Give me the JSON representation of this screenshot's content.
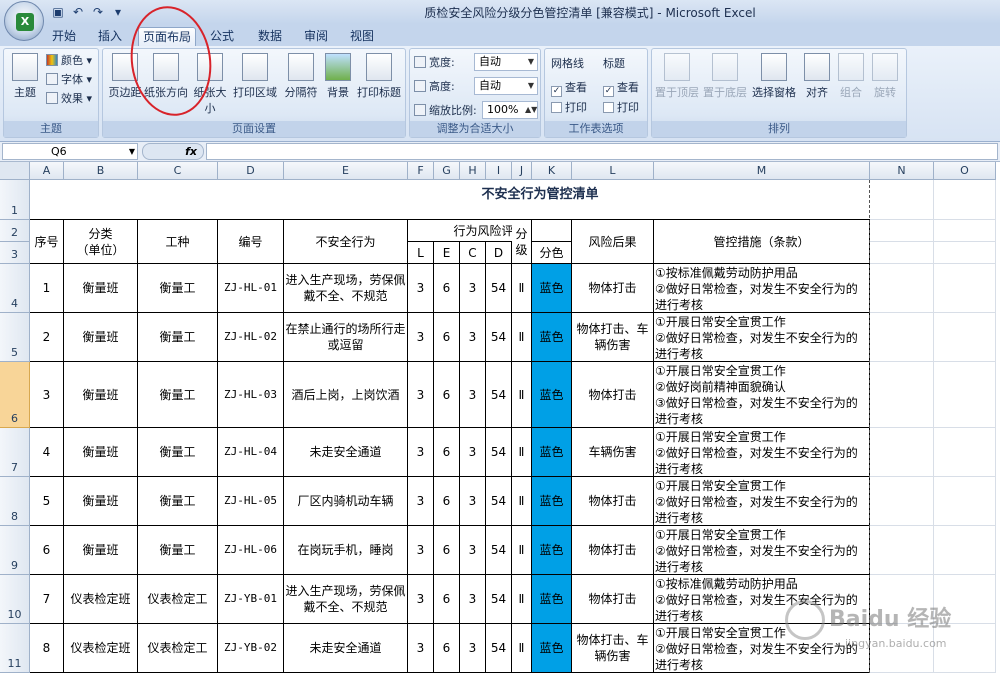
{
  "window": {
    "title": "质检安全风险分级分色管控清单 [兼容模式] - Microsoft Excel"
  },
  "tabs": [
    "开始",
    "插入",
    "页面布局",
    "公式",
    "数据",
    "审阅",
    "视图"
  ],
  "active_tab": "页面布局",
  "ribbon": {
    "theme": {
      "label": "主题",
      "big": "主题",
      "colors": "颜色",
      "fonts": "字体",
      "effects": "效果"
    },
    "pagesetup": {
      "label": "页面设置",
      "margins": "页边距",
      "orientation": "纸张方向",
      "size": "纸张大小",
      "printarea": "打印区域",
      "breaks": "分隔符",
      "background": "背景",
      "printtitles": "打印标题"
    },
    "scale": {
      "label": "调整为合适大小",
      "width_label": "宽度:",
      "width_value": "自动",
      "height_label": "高度:",
      "height_value": "自动",
      "scale_label": "缩放比例:",
      "scale_value": "100%"
    },
    "sheetopts": {
      "label": "工作表选项",
      "gridlines": "网格线",
      "headings": "标题",
      "view": "查看",
      "print": "打印"
    },
    "arrange": {
      "label": "排列",
      "front": "置于顶层",
      "back": "置于底层",
      "pane": "选择窗格",
      "align": "对齐",
      "group": "组合",
      "rotate": "旋转"
    }
  },
  "formula_bar": {
    "name_box": "Q6",
    "fx": "fx",
    "content": ""
  },
  "columns": [
    "A",
    "B",
    "C",
    "D",
    "E",
    "F",
    "G",
    "H",
    "I",
    "J",
    "K",
    "L",
    "M",
    "N",
    "O"
  ],
  "rows": [
    "1",
    "2",
    "3",
    "4",
    "5",
    "6",
    "7",
    "8",
    "9",
    "10",
    "11"
  ],
  "sheet": {
    "title": "不安全行为管控清单",
    "headers": {
      "seq": "序号",
      "category": "分类\n（单位）",
      "job": "工种",
      "code": "编号",
      "behavior": "不安全行为",
      "eval": "行为风险评价",
      "L": "L",
      "E": "E",
      "C": "C",
      "D": "D",
      "level": "分级",
      "color": "分色",
      "consequence": "风险后果",
      "measures": "管控措施（条款）"
    },
    "records": [
      {
        "seq": "1",
        "category": "衡量班",
        "job": "衡量工",
        "code": "ZJ-HL-01",
        "behavior": "进入生产现场，劳保佩戴不全、不规范",
        "L": "3",
        "E": "6",
        "C": "3",
        "D": "54",
        "level": "Ⅱ",
        "color": "蓝色",
        "consequence": "物体打击",
        "measures": "①按标准佩戴劳动防护用品\n②做好日常检查，对发生不安全行为的进行考核"
      },
      {
        "seq": "2",
        "category": "衡量班",
        "job": "衡量工",
        "code": "ZJ-HL-02",
        "behavior": "在禁止通行的场所行走或逗留",
        "L": "3",
        "E": "6",
        "C": "3",
        "D": "54",
        "level": "Ⅱ",
        "color": "蓝色",
        "consequence": "物体打击、车辆伤害",
        "measures": "①开展日常安全宣贯工作\n②做好日常检查，对发生不安全行为的进行考核"
      },
      {
        "seq": "3",
        "category": "衡量班",
        "job": "衡量工",
        "code": "ZJ-HL-03",
        "behavior": "酒后上岗，上岗饮酒",
        "L": "3",
        "E": "6",
        "C": "3",
        "D": "54",
        "level": "Ⅱ",
        "color": "蓝色",
        "consequence": "物体打击",
        "measures": "①开展日常安全宣贯工作\n②做好岗前精神面貌确认\n③做好日常检查，对发生不安全行为的进行考核"
      },
      {
        "seq": "4",
        "category": "衡量班",
        "job": "衡量工",
        "code": "ZJ-HL-04",
        "behavior": "未走安全通道",
        "L": "3",
        "E": "6",
        "C": "3",
        "D": "54",
        "level": "Ⅱ",
        "color": "蓝色",
        "consequence": "车辆伤害",
        "measures": "①开展日常安全宣贯工作\n②做好日常检查，对发生不安全行为的进行考核"
      },
      {
        "seq": "5",
        "category": "衡量班",
        "job": "衡量工",
        "code": "ZJ-HL-05",
        "behavior": "厂区内骑机动车辆",
        "L": "3",
        "E": "6",
        "C": "3",
        "D": "54",
        "level": "Ⅱ",
        "color": "蓝色",
        "consequence": "物体打击",
        "measures": "①开展日常安全宣贯工作\n②做好日常检查，对发生不安全行为的进行考核"
      },
      {
        "seq": "6",
        "category": "衡量班",
        "job": "衡量工",
        "code": "ZJ-HL-06",
        "behavior": "在岗玩手机，睡岗",
        "L": "3",
        "E": "6",
        "C": "3",
        "D": "54",
        "level": "Ⅱ",
        "color": "蓝色",
        "consequence": "物体打击",
        "measures": "①开展日常安全宣贯工作\n②做好日常检查，对发生不安全行为的进行考核"
      },
      {
        "seq": "7",
        "category": "仪表检定班",
        "job": "仪表检定工",
        "code": "ZJ-YB-01",
        "behavior": "进入生产现场，劳保佩戴不全、不规范",
        "L": "3",
        "E": "6",
        "C": "3",
        "D": "54",
        "level": "Ⅱ",
        "color": "蓝色",
        "consequence": "物体打击",
        "measures": "①按标准佩戴劳动防护用品\n②做好日常检查，对发生不安全行为的进行考核"
      },
      {
        "seq": "8",
        "category": "仪表检定班",
        "job": "仪表检定工",
        "code": "ZJ-YB-02",
        "behavior": "未走安全通道",
        "L": "3",
        "E": "6",
        "C": "3",
        "D": "54",
        "level": "Ⅱ",
        "color": "蓝色",
        "consequence": "物体打击、车辆伤害",
        "measures": "①开展日常安全宣贯工作\n②做好日常检查，对发生不安全行为的进行考核"
      }
    ]
  },
  "watermark": {
    "text": "Baidu 经验",
    "sub": "jingyan.baidu.com"
  },
  "colors": {
    "level_blue": "#00a0e6",
    "annotation_red": "#d8232a"
  }
}
